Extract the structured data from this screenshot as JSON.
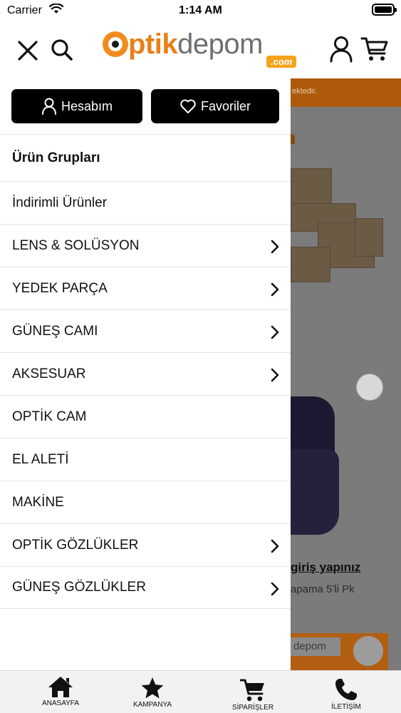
{
  "status_bar": {
    "carrier": "Carrier",
    "time": "1:14 AM"
  },
  "header": {
    "logo_text_primary": "ptik",
    "logo_text_secondary": "depom",
    "logo_com": ".com",
    "icons": [
      "close-icon",
      "search-icon",
      "user-icon",
      "cart-icon"
    ]
  },
  "drawer": {
    "account_button": "Hesabım",
    "favorites_button": "Favoriler",
    "menu_items": [
      {
        "label": "Ürün Grupları",
        "has_submenu": false,
        "is_header": true
      },
      {
        "label": "İndirimli Ürünler",
        "has_submenu": false
      },
      {
        "label": "LENS & SOLÜSYON",
        "has_submenu": true
      },
      {
        "label": "YEDEK PARÇA",
        "has_submenu": true
      },
      {
        "label": "GÜNEŞ CAMI",
        "has_submenu": true
      },
      {
        "label": "AKSESUAR",
        "has_submenu": true
      },
      {
        "label": "OPTİK CAM",
        "has_submenu": false
      },
      {
        "label": "EL ALETİ",
        "has_submenu": false
      },
      {
        "label": "MAKİNE",
        "has_submenu": false
      },
      {
        "label": "OPTİK GÖZLÜKLER",
        "has_submenu": true
      },
      {
        "label": "GÜNEŞ GÖZLÜKLER",
        "has_submenu": true
      }
    ]
  },
  "background_page": {
    "banner_text": "ektedir.",
    "login_link": "giriş yapınız",
    "product_desc": "apama 5'li Pk",
    "card_text": "depom"
  },
  "tabbar": {
    "tabs": [
      {
        "label": "ANASAYFA",
        "icon": "home-icon"
      },
      {
        "label": "KAMPANYA",
        "icon": "star-icon"
      },
      {
        "label": "SİPARİŞLER",
        "icon": "cart-icon"
      },
      {
        "label": "İLETİŞİM",
        "icon": "phone-icon"
      }
    ]
  },
  "colors": {
    "brand_orange": "#f08c1f",
    "button_black": "#000000",
    "divider": "#e3e3e3"
  }
}
